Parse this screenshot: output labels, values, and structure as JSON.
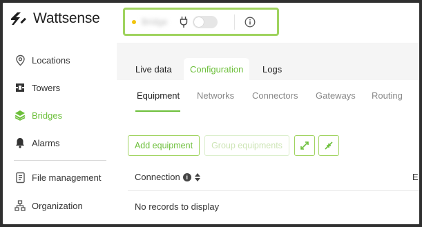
{
  "app": {
    "logo_text": "Wattsense",
    "brand_color": "#6cbf3a"
  },
  "device": {
    "name": "Bridge",
    "status_color": "#f1c40f",
    "toggle_on": false
  },
  "sidebar": {
    "items": [
      {
        "label": "Locations",
        "icon": "location-pin-icon"
      },
      {
        "label": "Towers",
        "icon": "tower-icon"
      },
      {
        "label": "Bridges",
        "icon": "bridges-icon",
        "active": true
      },
      {
        "label": "Alarms",
        "icon": "bell-icon"
      },
      {
        "label": "File management",
        "icon": "file-icon"
      },
      {
        "label": "Organization",
        "icon": "organization-icon"
      }
    ]
  },
  "tabs": [
    {
      "label": "Live data"
    },
    {
      "label": "Configuration",
      "selected": true
    },
    {
      "label": "Logs"
    }
  ],
  "subtabs": [
    {
      "label": "Equipment",
      "selected": true
    },
    {
      "label": "Networks"
    },
    {
      "label": "Connectors"
    },
    {
      "label": "Gateways"
    },
    {
      "label": "Routing"
    }
  ],
  "actions": {
    "add_label": "Add equipment",
    "group_label": "Group equipments"
  },
  "table": {
    "columns": [
      "Connection",
      "E"
    ],
    "empty_text": "No records to display"
  }
}
